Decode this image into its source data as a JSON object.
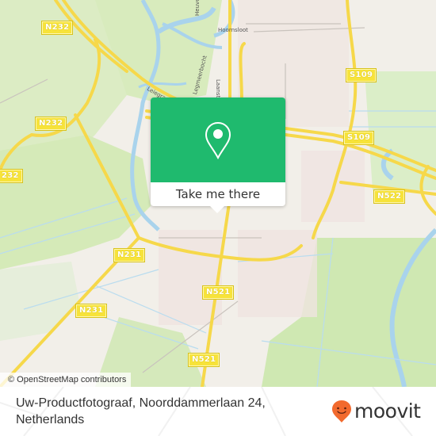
{
  "map": {
    "road_shields": [
      {
        "id": "n232-top",
        "label": "N232"
      },
      {
        "id": "n232-mid",
        "label": "N232"
      },
      {
        "id": "n232-left",
        "label": "232"
      },
      {
        "id": "s109-top",
        "label": "S109"
      },
      {
        "id": "s109-mid",
        "label": "S109"
      },
      {
        "id": "n522",
        "label": "N522"
      },
      {
        "id": "n231-top",
        "label": "N231"
      },
      {
        "id": "n231-bottom",
        "label": "N231"
      },
      {
        "id": "n521-top",
        "label": "N521"
      },
      {
        "id": "n521-bottom",
        "label": "N521"
      }
    ],
    "street_labels": [
      {
        "id": "hoornsloot",
        "label": "Hoornsloot"
      },
      {
        "id": "heuvelbocht",
        "label": "Heuvelbocht"
      },
      {
        "id": "legmeerbocht",
        "label": "Legmeerbocht"
      },
      {
        "id": "leiegracht",
        "label": "Leiegracht"
      },
      {
        "id": "laanstra",
        "label": "Laanstra"
      }
    ],
    "attribution": "© OpenStreetMap contributors",
    "colors": {
      "land": "#f2efe9",
      "park": "#d7ecbb",
      "water": "#a9d3ec",
      "road": "#f6d84a"
    }
  },
  "popup": {
    "icon": "map-pin-icon",
    "cta_label": "Take me there",
    "accent": "#1fba6e"
  },
  "footer": {
    "address": "Uw-Productfotograaf, Noorddammerlaan 24, Netherlands",
    "brand": "moovit",
    "brand_color": "#f26a2e"
  }
}
